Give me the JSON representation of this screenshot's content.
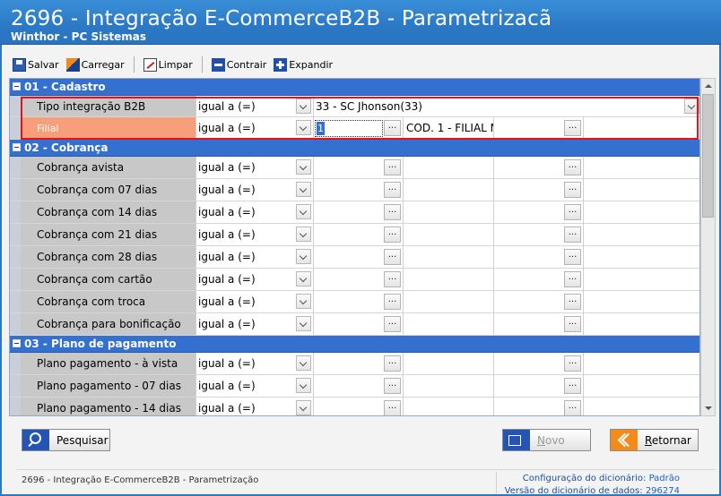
{
  "window": {
    "title": "2696 - Integração E-CommerceB2B - Parametrizacã",
    "subtitle": "Winthor - PC Sistemas"
  },
  "toolbar": {
    "save": "Salvar",
    "load": "Carregar",
    "clear": "Limpar",
    "collapse": "Contrair",
    "expand": "Expandir"
  },
  "grid": {
    "ellipsis": "...",
    "sections": [
      {
        "title": "01 - Cadastro",
        "rows": [
          {
            "label": "Tipo integração B2B",
            "operator": "igual a (=)",
            "value": "33 - SC Jhonson(33)"
          },
          {
            "label": "Filial",
            "operator": "igual a (=)",
            "value": "1",
            "description": "COD. 1 - FILIAL M"
          }
        ]
      },
      {
        "title": "02 - Cobrança",
        "rows": [
          {
            "label": "Cobrança  avista",
            "operator": "igual a (=)"
          },
          {
            "label": "Cobrança  com 07 dias",
            "operator": "igual a (=)"
          },
          {
            "label": "Cobrança  com 14 dias",
            "operator": "igual a (=)"
          },
          {
            "label": "Cobrança  com 21 dias",
            "operator": "igual a (=)"
          },
          {
            "label": "Cobrança  com 28 dias",
            "operator": "igual a (=)"
          },
          {
            "label": "Cobrança  com cartão",
            "operator": "igual a (=)"
          },
          {
            "label": "Cobrança  com troca",
            "operator": "igual a (=)"
          },
          {
            "label": "Cobrança para bonificação",
            "operator": "igual a (=)"
          }
        ]
      },
      {
        "title": "03 - Plano de pagamento",
        "rows": [
          {
            "label": "Plano pagamento - à vista",
            "operator": "igual a (=)"
          },
          {
            "label": "Plano pagamento - 07 dias",
            "operator": "igual a (=)"
          },
          {
            "label": "Plano pagamento - 14 dias",
            "operator": "igual a (=)"
          }
        ]
      }
    ]
  },
  "buttons": {
    "search": "Pesquisar",
    "new": "Novo",
    "back": "Retornar"
  },
  "status": {
    "left": "2696 - Integração E-CommerceB2B - Parametrização",
    "dict_config_label": "Configuração do dicionário:",
    "dict_config_value": "Padrão",
    "data_version_label": "Versão do dicionário de dados:",
    "data_version_value": "296274"
  },
  "colors": {
    "title_bar": "#2b78c5",
    "section_header": "#3470cf",
    "highlight_row": "#f79e7a",
    "callout_border": "#e0141c"
  }
}
